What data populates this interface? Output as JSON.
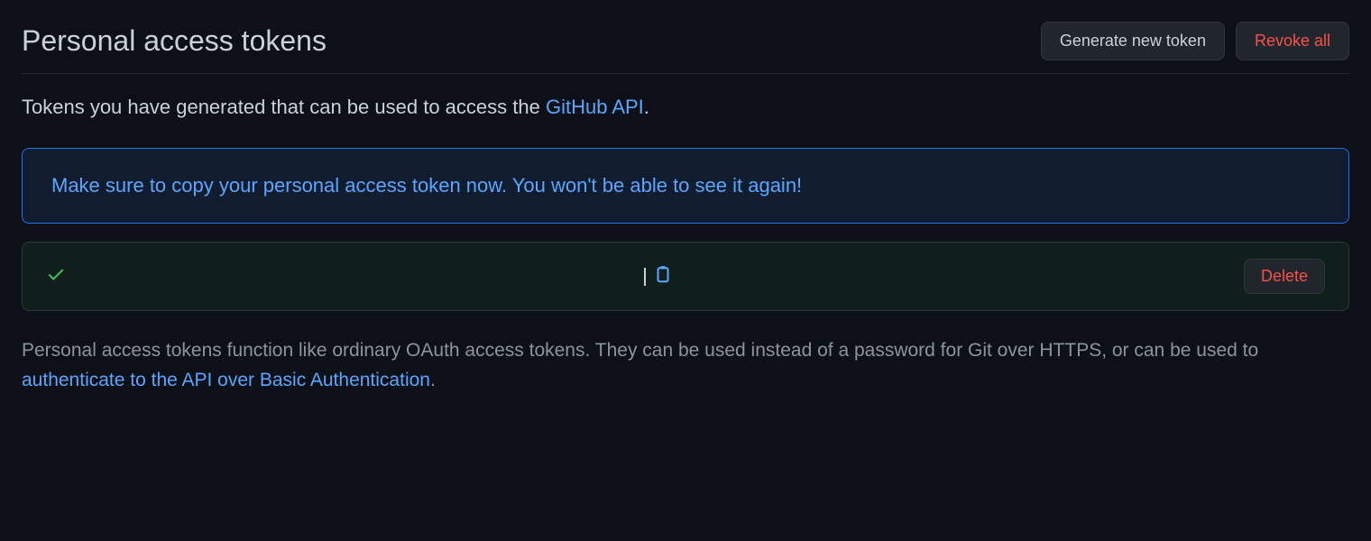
{
  "header": {
    "title": "Personal access tokens",
    "generate_label": "Generate new token",
    "revoke_label": "Revoke all"
  },
  "intro": {
    "text_before": "Tokens you have generated that can be used to access the ",
    "link_text": "GitHub API",
    "text_after": "."
  },
  "alert": {
    "message": "Make sure to copy your personal access token now. You won't be able to see it again!"
  },
  "token": {
    "value": "",
    "delete_label": "Delete"
  },
  "footer": {
    "text_before": "Personal access tokens function like ordinary OAuth access tokens. They can be used instead of a password for Git over HTTPS, or can be used to ",
    "link_text": "authenticate to the API over Basic Authentication",
    "text_after": "."
  }
}
